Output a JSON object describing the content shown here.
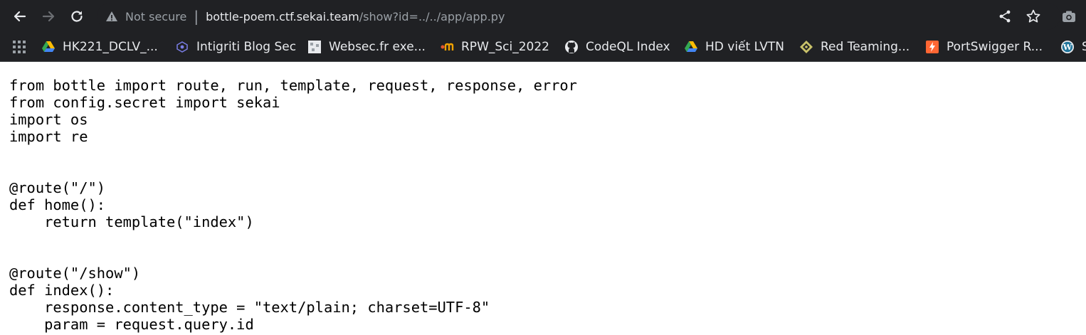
{
  "browser": {
    "security_label": "Not secure",
    "url_host": "bottle-poem.ctf.sekai.team",
    "url_path": "/show?id=../../app/app.py"
  },
  "bookmarks": [
    {
      "label": "HK221_DCLV_...",
      "icon": "google-drive-icon"
    },
    {
      "label": "Intigriti Blog Sec",
      "icon": "intigriti-icon"
    },
    {
      "label": "Websec.fr exe...",
      "icon": "websec-icon"
    },
    {
      "label": "RPW_Sci_2022",
      "icon": "mendeley-icon"
    },
    {
      "label": "CodeQL Index",
      "icon": "github-icon"
    },
    {
      "label": "HD viết LVTN",
      "icon": "google-drive-icon"
    },
    {
      "label": "Red Teaming...",
      "icon": "diamond-icon"
    },
    {
      "label": "PortSwigger R...",
      "icon": "portswigger-icon"
    },
    {
      "label": "S",
      "icon": "wordpress-icon"
    }
  ],
  "page": {
    "source_lines": [
      "from bottle import route, run, template, request, response, error",
      "from config.secret import sekai",
      "import os",
      "import re",
      "",
      "",
      "@route(\"/\")",
      "def home():",
      "    return template(\"index\")",
      "",
      "",
      "@route(\"/show\")",
      "def index():",
      "    response.content_type = \"text/plain; charset=UTF-8\"",
      "    param = request.query.id"
    ]
  },
  "colors": {
    "toolbar_bg": "#202124",
    "toolbar_text": "#e8eaed",
    "muted_text": "#9aa0a6",
    "page_bg": "#ffffff",
    "code_text": "#000000"
  }
}
